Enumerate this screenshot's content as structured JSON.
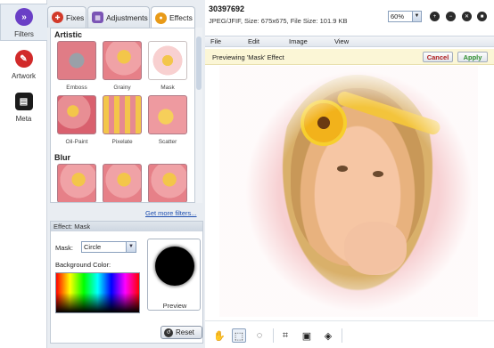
{
  "nav": {
    "items": [
      {
        "label": "Filters",
        "icon": "fast-forward-icon",
        "color": "#6a3fc6"
      },
      {
        "label": "Artwork",
        "icon": "artwork-icon",
        "color": "#d12a2a"
      },
      {
        "label": "Meta",
        "icon": "meta-icon",
        "color": "#1b1b1b"
      }
    ]
  },
  "tabs": [
    {
      "label": "Fixes",
      "color": "#d23a2a"
    },
    {
      "label": "Adjustments",
      "color": "#7b55b5"
    },
    {
      "label": "Effects",
      "color": "#e89a18"
    }
  ],
  "filters": {
    "artistic_heading": "Artistic",
    "artistic": [
      "Emboss",
      "Grainy",
      "Mask",
      "Oil-Paint",
      "Pixelate",
      "Scatter"
    ],
    "blur_heading": "Blur",
    "more_link": "Get more filters..."
  },
  "effect": {
    "heading": "Effect: Mask",
    "mask_label": "Mask:",
    "mask_value": "Circle",
    "bg_label": "Background Color:",
    "preview_label": "Preview",
    "reset_label": "Reset"
  },
  "image": {
    "id": "30397692",
    "info": "JPEG/JFIF, Size: 675x675, File Size: 101.9 KB",
    "zoom": "60%"
  },
  "menu": [
    "File",
    "Edit",
    "Image",
    "View"
  ],
  "notice": {
    "text": "Previewing 'Mask' Effect",
    "cancel": "Cancel",
    "apply": "Apply"
  },
  "colors": {
    "accent": "#2f8f2f",
    "cancel_text": "#b01e1e",
    "link": "#1f4fb0"
  }
}
